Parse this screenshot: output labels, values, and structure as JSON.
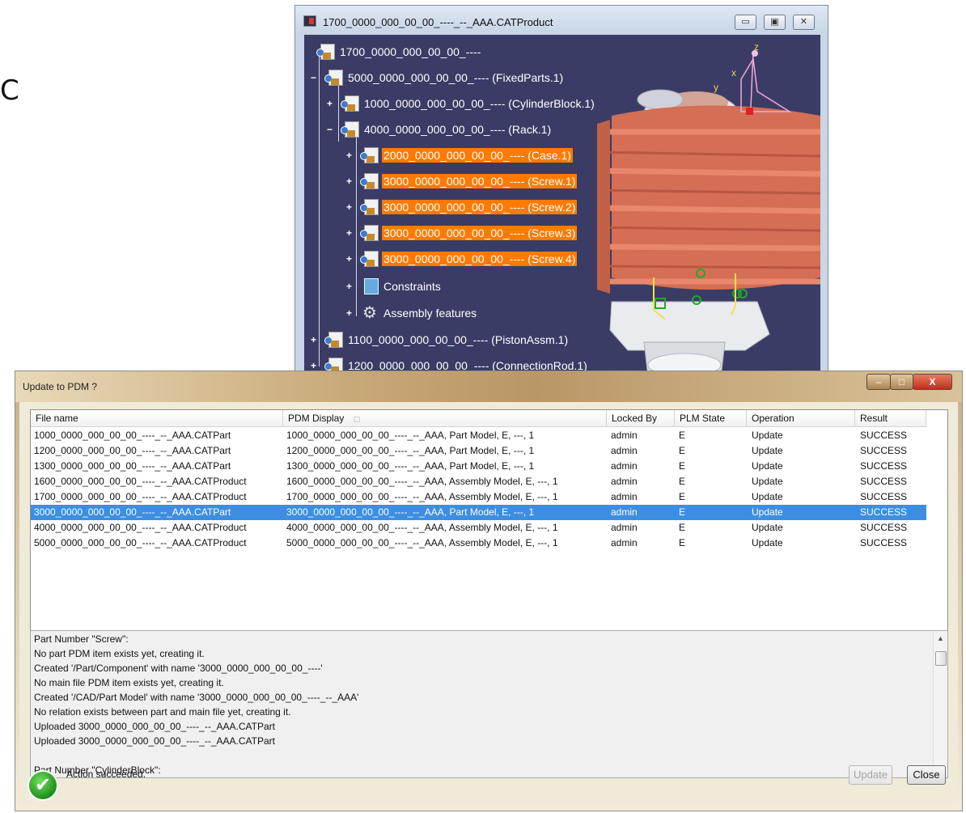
{
  "side_letter": "C",
  "catia_window": {
    "title": "1700_0000_000_00_00_----_--_AAA.CATProduct",
    "buttons": {
      "minimize": "▭",
      "restore": "▣",
      "close": "✕"
    },
    "tree": [
      {
        "toggle": "",
        "label": "1700_0000_000_00_00_----",
        "highlighted": false,
        "icon": "product-icon"
      },
      {
        "toggle": "−",
        "label": "5000_0000_000_00_00_---- (FixedParts.1)",
        "highlighted": false,
        "icon": "product-icon"
      },
      {
        "toggle": "+",
        "label": "1000_0000_000_00_00_---- (CylinderBlock.1)",
        "highlighted": false,
        "icon": "part-icon"
      },
      {
        "toggle": "−",
        "label": "4000_0000_000_00_00_---- (Rack.1)",
        "highlighted": false,
        "icon": "product-icon"
      },
      {
        "toggle": "+",
        "label": "2000_0000_000_00_00_---- (Case.1)",
        "highlighted": true,
        "icon": "part-icon"
      },
      {
        "toggle": "+",
        "label": "3000_0000_000_00_00_---- (Screw.1)",
        "highlighted": true,
        "icon": "part-icon"
      },
      {
        "toggle": "+",
        "label": "3000_0000_000_00_00_---- (Screw.2)",
        "highlighted": true,
        "icon": "part-icon"
      },
      {
        "toggle": "+",
        "label": "3000_0000_000_00_00_---- (Screw.3)",
        "highlighted": true,
        "icon": "part-icon"
      },
      {
        "toggle": "+",
        "label": "3000_0000_000_00_00_---- (Screw.4)",
        "highlighted": true,
        "icon": "part-icon"
      },
      {
        "toggle": "+",
        "label": "Constraints",
        "highlighted": false,
        "icon": "constraints-icon"
      },
      {
        "toggle": "+",
        "label": "Assembly features",
        "highlighted": false,
        "icon": "assembly-features-icon"
      },
      {
        "toggle": "+",
        "label": "1100_0000_000_00_00_---- (PistonAssm.1)",
        "highlighted": false,
        "icon": "product-icon"
      },
      {
        "toggle": "+",
        "label": "1200_0000_000_00_00_---- (ConnectionRod.1)",
        "highlighted": false,
        "icon": "product-icon"
      }
    ],
    "compass_labels": {
      "z": "z",
      "x": "x",
      "y": "y"
    },
    "colors": {
      "background": "#3a3c66",
      "model": "#d9735a",
      "highlight": "#ff7a00"
    }
  },
  "dialog": {
    "title": "Update to PDM ?",
    "window_buttons": {
      "minimize": "–",
      "maximize": "□",
      "close": "X"
    },
    "columns": [
      "File name",
      "PDM Display",
      "Locked By",
      "PLM State",
      "Operation",
      "Result"
    ],
    "sort_indicator": "▢",
    "rows": [
      [
        "1000_0000_000_00_00_----_--_AAA.CATPart",
        "1000_0000_000_00_00_----_--_AAA, Part Model, E, ---, 1",
        "admin",
        "E",
        "Update",
        "SUCCESS"
      ],
      [
        "1200_0000_000_00_00_----_--_AAA.CATPart",
        "1200_0000_000_00_00_----_--_AAA, Part Model, E, ---, 1",
        "admin",
        "E",
        "Update",
        "SUCCESS"
      ],
      [
        "1300_0000_000_00_00_----_--_AAA.CATPart",
        "1300_0000_000_00_00_----_--_AAA, Part Model, E, ---, 1",
        "admin",
        "E",
        "Update",
        "SUCCESS"
      ],
      [
        "1600_0000_000_00_00_----_--_AAA.CATProduct",
        "1600_0000_000_00_00_----_--_AAA, Assembly Model, E, ---, 1",
        "admin",
        "E",
        "Update",
        "SUCCESS"
      ],
      [
        "1700_0000_000_00_00_----_--_AAA.CATProduct",
        "1700_0000_000_00_00_----_--_AAA, Assembly Model, E, ---, 1",
        "admin",
        "E",
        "Update",
        "SUCCESS"
      ],
      [
        "3000_0000_000_00_00_----_--_AAA.CATPart",
        "3000_0000_000_00_00_----_--_AAA, Part Model, E, ---, 1",
        "admin",
        "E",
        "Update",
        "SUCCESS"
      ],
      [
        "4000_0000_000_00_00_----_--_AAA.CATProduct",
        "4000_0000_000_00_00_----_--_AAA, Assembly Model, E, ---, 1",
        "admin",
        "E",
        "Update",
        "SUCCESS"
      ],
      [
        "5000_0000_000_00_00_----_--_AAA.CATProduct",
        "5000_0000_000_00_00_----_--_AAA, Assembly Model, E, ---, 1",
        "admin",
        "E",
        "Update",
        "SUCCESS"
      ]
    ],
    "selected_row": 5,
    "log_lines": [
      "Part Number \"Screw\":",
      "No part PDM item exists yet, creating it.",
      "Created '/Part/Component' with name '3000_0000_000_00_00_----'",
      "No main file PDM item exists yet, creating it.",
      "Created '/CAD/Part Model' with name '3000_0000_000_00_00_----_--_AAA'",
      "No relation exists between part and main file yet, creating it.",
      "Uploaded 3000_0000_000_00_00_----_--_AAA.CATPart",
      "Uploaded 3000_0000_000_00_00_----_--_AAA.CATPart",
      "",
      "Part Number \"CylinderBlock\":"
    ],
    "status_text": "Action succeeded.",
    "status_icon": "✔",
    "update_button": "Update",
    "close_button": "Close",
    "colors": {
      "selection": "#3d8ee0",
      "success": "#2f9f25"
    }
  }
}
